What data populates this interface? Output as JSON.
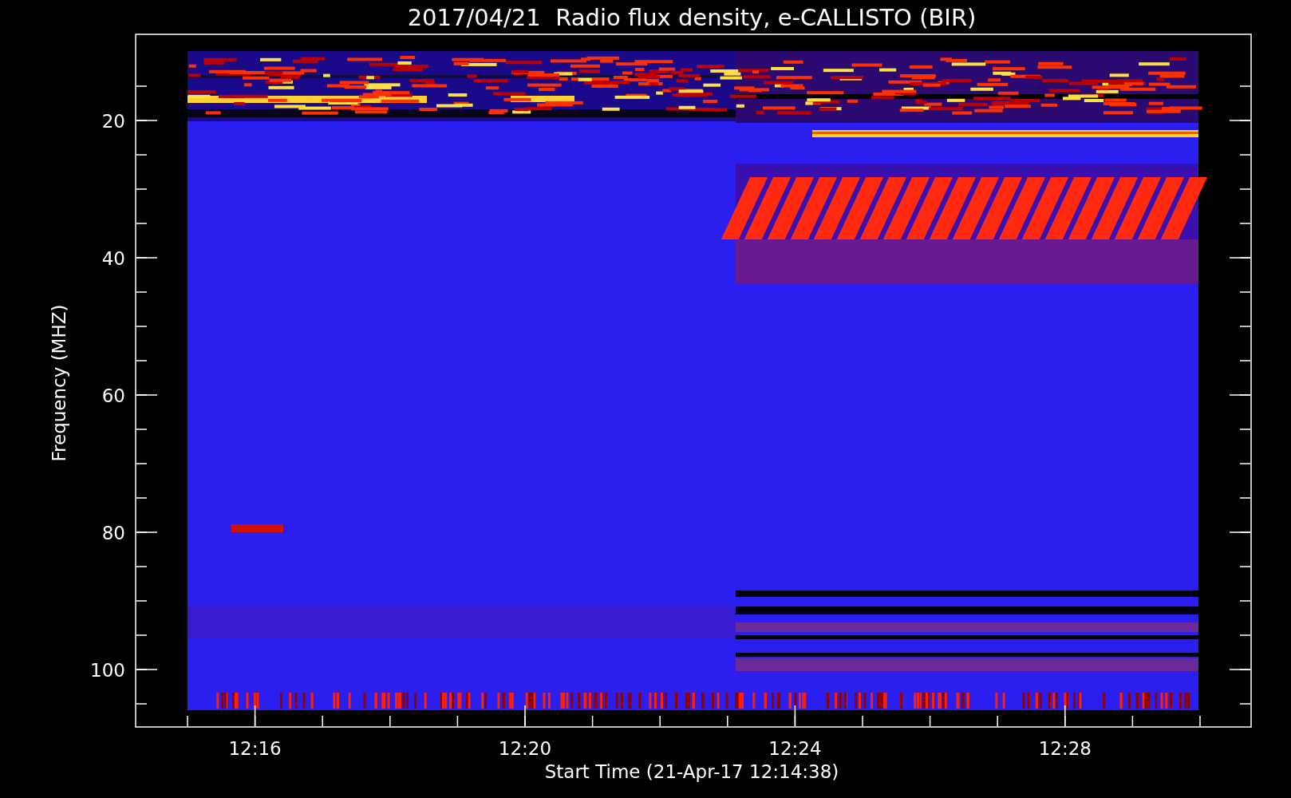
{
  "plot": {
    "title": "2017/04/21  Radio flux density, e-CALLISTO (BIR)",
    "y_axis": {
      "label": "Frequency (MHZ)",
      "ticks": [
        "20",
        "40",
        "60",
        "80",
        "100"
      ]
    },
    "x_axis": {
      "label": "Start Time (21-Apr-17 12:14:38)",
      "ticks": [
        "12:16",
        "12:20",
        "12:24",
        "12:28"
      ]
    }
  }
}
